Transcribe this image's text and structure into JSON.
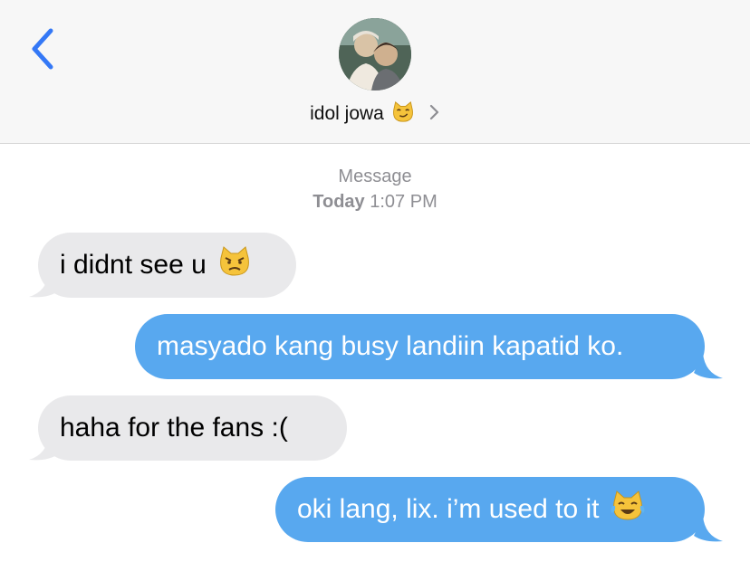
{
  "header": {
    "contact_name": "idol jowa",
    "contact_emoji": "smirk-cat-icon"
  },
  "thread": {
    "service_label": "Message",
    "day_label": "Today",
    "time_label": "1:07 PM"
  },
  "messages": [
    {
      "direction": "incoming",
      "text": "i didnt see u",
      "emoji": "pouting-cat-icon"
    },
    {
      "direction": "outgoing",
      "text": "masyado kang busy landiin kapatid ko."
    },
    {
      "direction": "incoming",
      "text": "haha for the fans :("
    },
    {
      "direction": "outgoing",
      "text": "oki lang, lix. i’m used to it",
      "emoji": "tears-of-joy-icon"
    }
  ],
  "colors": {
    "accent": "#3478f6",
    "outgoing_bubble": "#58a8ef",
    "incoming_bubble": "#e9e9eb",
    "meta_text": "#8e8e93"
  }
}
